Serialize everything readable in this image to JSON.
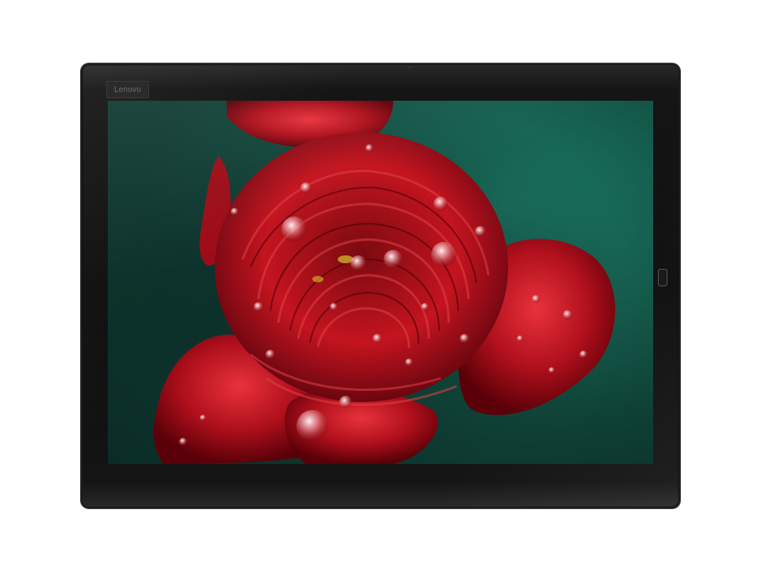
{
  "device": {
    "brand_label": "Lenovo"
  },
  "photo": {
    "subject": "red-ranunculus-flower-with-water-droplets",
    "colors": {
      "background": "#145a4b",
      "petal": "#b0101c",
      "petal_dark": "#5a0008",
      "highlight": "#e8323c"
    }
  }
}
